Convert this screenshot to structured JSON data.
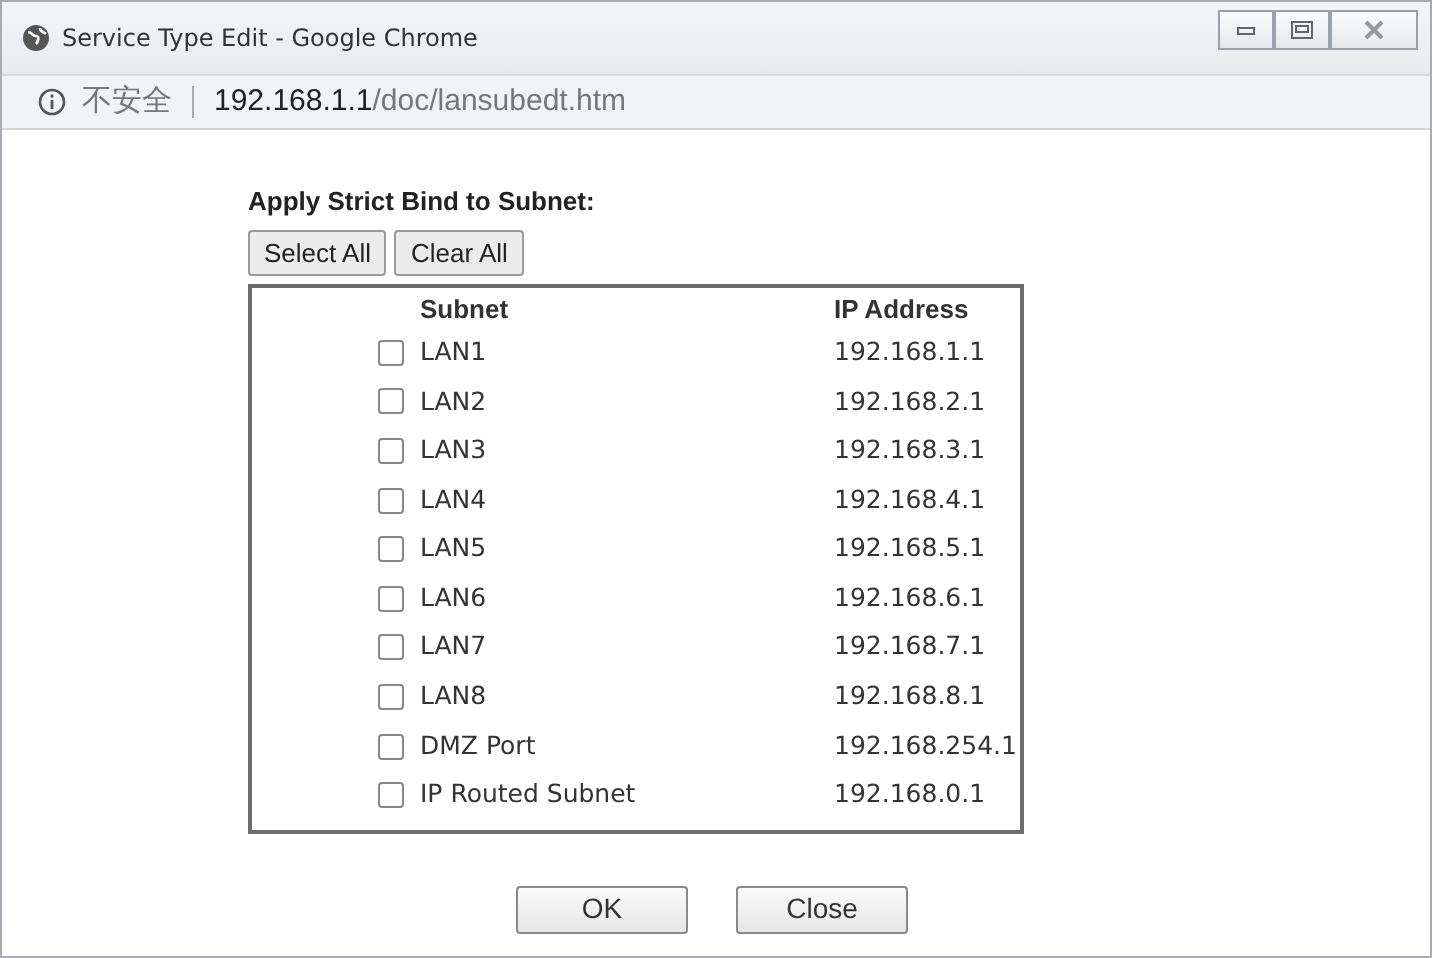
{
  "window": {
    "title": "Service Type Edit - Google Chrome"
  },
  "address_bar": {
    "security": "不安全",
    "host": "192.168.1.1",
    "path": "/doc/lansubedt.htm"
  },
  "heading": "Apply Strict Bind to Subnet:",
  "bulk_buttons": [
    "Select All",
    "Clear All"
  ],
  "table": {
    "columns": [
      "Subnet",
      "IP Address"
    ],
    "rows": [
      {
        "subnet": "LAN1",
        "ip": "192.168.1.1",
        "checked": false
      },
      {
        "subnet": "LAN2",
        "ip": "192.168.2.1",
        "checked": false
      },
      {
        "subnet": "LAN3",
        "ip": "192.168.3.1",
        "checked": false
      },
      {
        "subnet": "LAN4",
        "ip": "192.168.4.1",
        "checked": false
      },
      {
        "subnet": "LAN5",
        "ip": "192.168.5.1",
        "checked": false
      },
      {
        "subnet": "LAN6",
        "ip": "192.168.6.1",
        "checked": false
      },
      {
        "subnet": "LAN7",
        "ip": "192.168.7.1",
        "checked": false
      },
      {
        "subnet": "LAN8",
        "ip": "192.168.8.1",
        "checked": false
      },
      {
        "subnet": "DMZ Port",
        "ip": "192.168.254.1",
        "checked": false
      },
      {
        "subnet": "IP Routed Subnet",
        "ip": "192.168.0.1",
        "checked": false
      }
    ]
  },
  "buttons": [
    "OK",
    "Close"
  ]
}
